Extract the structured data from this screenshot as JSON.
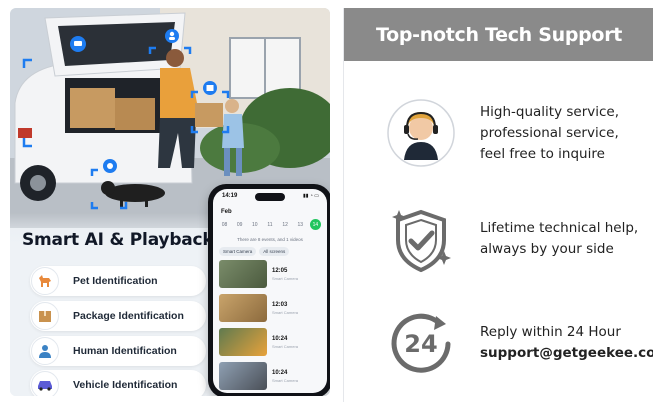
{
  "left": {
    "headline": "Smart AI & Playback",
    "features": [
      {
        "label": "Pet Identification",
        "icon": "dog-icon"
      },
      {
        "label": "Package Identification",
        "icon": "package-icon"
      },
      {
        "label": "Human Identification",
        "icon": "person-icon"
      },
      {
        "label": "Vehicle Identification",
        "icon": "car-icon"
      }
    ],
    "phone": {
      "time": "14:19",
      "month": "Feb",
      "days": [
        "08",
        "09",
        "10",
        "11",
        "12",
        "13",
        "14"
      ],
      "selected_day": "14",
      "events_text": "There are 8 events, and 1 videos",
      "chips": [
        "Smart Camera",
        "All screens"
      ],
      "clips": [
        {
          "time": "12:05",
          "sub": "Smart Camera"
        },
        {
          "time": "12:03",
          "sub": "Smart Camera"
        },
        {
          "time": "10:24",
          "sub": "Smart Camera"
        },
        {
          "time": "10:24",
          "sub": "Smart Camera"
        }
      ]
    }
  },
  "right": {
    "title": "Top-notch Tech Support",
    "rows": [
      {
        "icon": "support-agent-icon",
        "lines": [
          "High-quality service,",
          "professional service,",
          "feel free to inquire"
        ]
      },
      {
        "icon": "shield-check-icon",
        "lines": [
          "Lifetime technical help,",
          "always by your side"
        ]
      },
      {
        "icon": "clock-24-icon",
        "lines": [
          "Reply within 24 Hour"
        ],
        "email": "support@getgeekee.com"
      }
    ]
  },
  "colors": {
    "header_gray": "#8a8a8a",
    "accent_green": "#22c55e",
    "icon_gray": "#6b6b6b"
  }
}
